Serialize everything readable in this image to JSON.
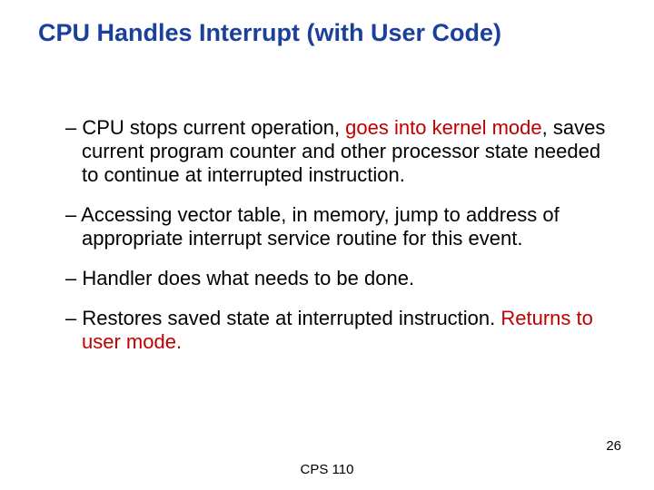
{
  "title": "CPU Handles Interrupt (with User Code)",
  "bullets": {
    "b1": {
      "dash": "– ",
      "pre": "CPU stops current operation, ",
      "hl": "goes into kernel mode",
      "post": ", saves current program counter and other processor state needed to continue at interrupted instruction."
    },
    "b2": {
      "dash": "– ",
      "text": "Accessing vector table, in memory, jump to address of appropriate interrupt service routine for this event."
    },
    "b3": {
      "dash": "– ",
      "text": "Handler does what needs to be done."
    },
    "b4": {
      "dash": "– ",
      "pre": "Restores saved state at interrupted instruction. ",
      "hl": "Returns to user mode."
    }
  },
  "footer": "CPS 110",
  "page": "26"
}
